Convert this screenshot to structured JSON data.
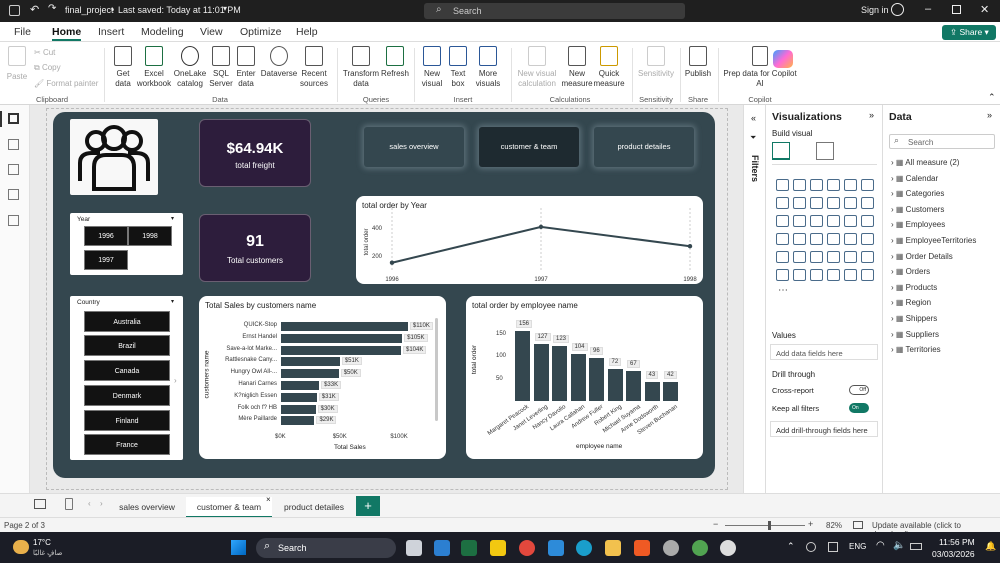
{
  "titlebar": {
    "file": "final_project",
    "saved": "Last saved: Today at 11:01 PM",
    "search": "Search",
    "signin": "Sign in"
  },
  "menu": [
    "File",
    "Home",
    "Insert",
    "Modeling",
    "View",
    "Optimize",
    "Help"
  ],
  "share": "Share",
  "ribbon": {
    "clipboard": {
      "paste": "Paste",
      "cut": "Cut",
      "copy": "Copy",
      "format": "Format painter",
      "group": "Clipboard"
    },
    "data": {
      "items": [
        "Get data",
        "Excel workbook",
        "OneLake catalog",
        "SQL Server",
        "Enter data",
        "Dataverse",
        "Recent sources"
      ],
      "group": "Data"
    },
    "queries": {
      "items": [
        "Transform data",
        "Refresh"
      ],
      "group": "Queries"
    },
    "insert": {
      "items": [
        "New visual",
        "Text box",
        "More visuals"
      ],
      "group": "Insert"
    },
    "calcs": {
      "items": [
        "New visual calculation",
        "New measure",
        "Quick measure"
      ],
      "group": "Calculations"
    },
    "sens": {
      "items": [
        "Sensitivity"
      ],
      "group": "Sensitivity"
    },
    "share": {
      "items": [
        "Publish"
      ],
      "group": "Share"
    },
    "copilot": {
      "items": [
        "Prep data for Copilot",
        "AI"
      ],
      "group": "Copilot"
    }
  },
  "report": {
    "freight_value": "$64.94K",
    "freight_label": "total freight",
    "customers_value": "91",
    "customers_label": "Total customers",
    "nav": [
      "sales overview",
      "customer & team",
      "product detailes"
    ],
    "year_slicer": {
      "title": "Year",
      "years": [
        "1996",
        "1998",
        "1997"
      ]
    },
    "country_slicer": {
      "title": "Country",
      "items": [
        "Australia",
        "Brazil",
        "Canada",
        "Denmark",
        "Finland",
        "France"
      ]
    },
    "line_title": "total order by Year",
    "sales_title": "Total Sales by customers name",
    "sales_xlabel": "Total Sales",
    "sales_ylabel": "customers name",
    "emp_title": "total order by employee name",
    "emp_xlabel": "employee name",
    "emp_ylabel": "total order"
  },
  "chart_data": [
    {
      "type": "line",
      "title": "total order by Year",
      "x": [
        "1996",
        "1997",
        "1998"
      ],
      "values": [
        152,
        408,
        270
      ],
      "ylabel": "total order",
      "yticks": [
        "200",
        "400"
      ],
      "ylim": [
        100,
        500
      ]
    },
    {
      "type": "bar",
      "title": "Total Sales by customers name",
      "categories": [
        "QUICK-Stop",
        "Ernst Handel",
        "Save-a-lot Marke...",
        "Rattlesnake Cany...",
        "Hungry Owl All-...",
        "Hanari Carnes",
        "K?niglich Essen",
        "Folk och f? HB",
        "Mère Paillarde"
      ],
      "values": [
        110,
        105,
        104,
        51,
        50,
        33,
        31,
        30,
        29
      ],
      "data_labels": [
        "$110K",
        "$105K",
        "$104K",
        "$51K",
        "$50K",
        "$33K",
        "$31K",
        "$30K",
        "$29K"
      ],
      "xticks": [
        "$0K",
        "$50K",
        "$100K"
      ],
      "xlim": [
        0,
        130
      ],
      "xlabel": "Total Sales",
      "ylabel": "customers name"
    },
    {
      "type": "bar",
      "title": "total order by employee name",
      "categories": [
        "Margaret Peacock",
        "Janet Leverling",
        "Nancy Davolio",
        "Laura Callahan",
        "Andrew Fuller",
        "Robert King",
        "Michael Suyama",
        "Anne Dodsworth",
        "Steven Buchanan"
      ],
      "values": [
        156,
        127,
        123,
        104,
        96,
        72,
        67,
        43,
        42
      ],
      "xlabel": "employee name",
      "ylabel": "total order",
      "yticks": [
        "0",
        "50",
        "100",
        "150"
      ],
      "ylim": [
        0,
        160
      ]
    }
  ],
  "panels": {
    "visualizations": "Visualizations",
    "build": "Build visual",
    "values": "Values",
    "add_fields": "Add data fields here",
    "drill": "Drill through",
    "cross": "Cross-report",
    "cross_state": "Off",
    "keep": "Keep all filters",
    "keep_state": "On",
    "add_drill": "Add drill-through fields here",
    "filters": "Filters",
    "data": "Data",
    "data_search": "Search",
    "tables": [
      "All measure (2)",
      "Calendar",
      "Categories",
      "Customers",
      "Employees",
      "EmployeeTerritories",
      "Order Details",
      "Orders",
      "Products",
      "Region",
      "Shippers",
      "Suppliers",
      "Territories"
    ]
  },
  "pages": [
    "sales overview",
    "customer & team",
    "product detailes"
  ],
  "status": {
    "page": "Page 2 of 3",
    "zoom": "82%",
    "update": "Update available (click to download)"
  },
  "taskbar": {
    "temp": "17°C",
    "weather": "صافٍ غالبًا",
    "search": "Search",
    "lang": "ENG",
    "time": "11:56 PM",
    "date": "03/03/2026"
  },
  "colors": {
    "bar": "#34474f",
    "accent": "#117865",
    "kpi": "#2d1d3c"
  }
}
